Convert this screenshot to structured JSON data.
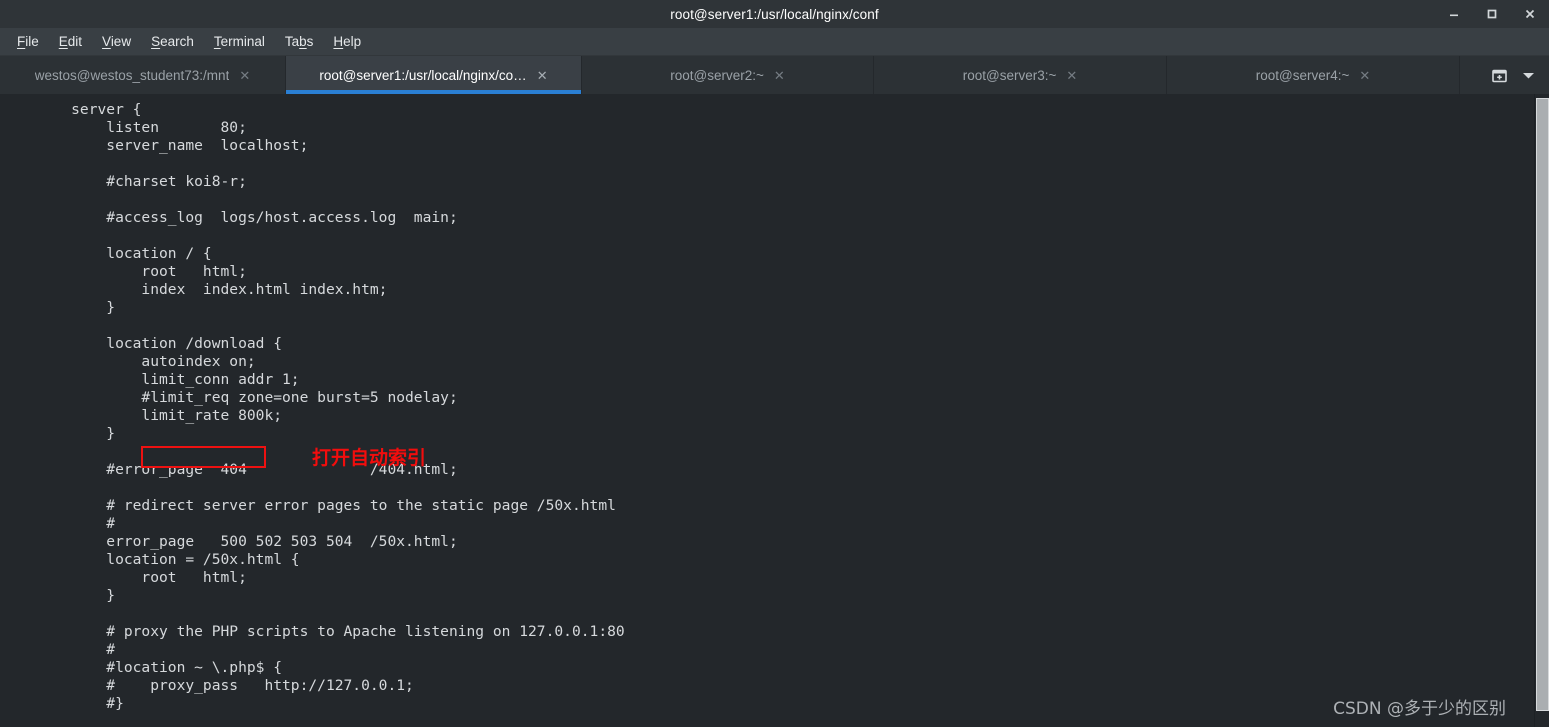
{
  "window": {
    "title": "root@server1:/usr/local/nginx/conf",
    "controls": [
      {
        "name": "minimize",
        "label": "–"
      },
      {
        "name": "maximize",
        "label": "□"
      },
      {
        "name": "close",
        "label": "×"
      }
    ]
  },
  "menubar": {
    "items": [
      {
        "label": "File",
        "mnemonic": "F"
      },
      {
        "label": "Edit",
        "mnemonic": "E"
      },
      {
        "label": "View",
        "mnemonic": "V"
      },
      {
        "label": "Search",
        "mnemonic": "S"
      },
      {
        "label": "Terminal",
        "mnemonic": "T"
      },
      {
        "label": "Tabs",
        "mnemonic": "b"
      },
      {
        "label": "Help",
        "mnemonic": "H"
      }
    ]
  },
  "tabbar": {
    "active_index": 1,
    "active_underline_color": "#2a7fd4",
    "close_glyph": "✕",
    "tabs": [
      {
        "label": "westos@westos_student73:/mnt",
        "active": false
      },
      {
        "label": "root@server1:/usr/local/nginx/co…",
        "active": true
      },
      {
        "label": "root@server2:~",
        "active": false
      },
      {
        "label": "root@server3:~",
        "active": false
      },
      {
        "label": "root@server4:~",
        "active": false
      }
    ],
    "actions": [
      {
        "name": "new-tab-icon",
        "label": "new tab"
      },
      {
        "name": "tab-list-chevron-down-icon",
        "label": "tab list"
      }
    ]
  },
  "terminal": {
    "background": "#23272b",
    "foreground": "#d6d9dc",
    "content": "    server {\n        listen       80;\n        server_name  localhost;\n\n        #charset koi8-r;\n\n        #access_log  logs/host.access.log  main;\n\n        location / {\n            root   html;\n            index  index.html index.htm;\n        }\n\n        location /download {\n            autoindex on;\n            limit_conn addr 1;\n            #limit_req zone=one burst=5 nodelay;\n            limit_rate 800k;\n        }\n\n        #error_page  404              /404.html;\n\n        # redirect server error pages to the static page /50x.html\n        #\n        error_page   500 502 503 504  /50x.html;\n        location = /50x.html {\n            root   html;\n        }\n\n        # proxy the PHP scripts to Apache listening on 127.0.0.1:80\n        #\n        #location ~ \\.php$ {\n        #    proxy_pass   http://127.0.0.1;\n        #}"
  },
  "annotations": {
    "highlight_box": {
      "target_text": "autoindex on;",
      "color": "#ee1111"
    },
    "note": {
      "text": "打开自动索引",
      "color": "#f20d0d"
    }
  },
  "watermark": {
    "text": "CSDN @多于少的区别"
  },
  "scrollbar": {
    "orientation": "vertical",
    "thumb_color": "#aaaeb1"
  }
}
